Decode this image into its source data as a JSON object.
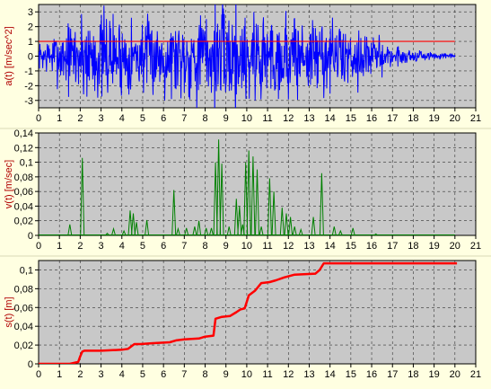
{
  "window": {
    "background": "#FFFFE1"
  },
  "chart_data": [
    {
      "type": "line",
      "ylabel": "a(t) [m/sec^2]",
      "xlim": [
        0,
        21
      ],
      "ylim": [
        -3.5,
        3.5
      ],
      "xticks": [
        "0",
        "1",
        "2",
        "3",
        "4",
        "5",
        "6",
        "7",
        "8",
        "9",
        "10",
        "11",
        "12",
        "13",
        "14",
        "15",
        "16",
        "17",
        "18",
        "19",
        "20",
        "21"
      ],
      "yticks": [
        {
          "v": -3,
          "label": "-3"
        },
        {
          "v": -2,
          "label": "-2"
        },
        {
          "v": -1,
          "label": "-1"
        },
        {
          "v": 0,
          "label": "0"
        },
        {
          "v": 1,
          "label": "1"
        },
        {
          "v": 2,
          "label": "2"
        },
        {
          "v": 3,
          "label": "3"
        }
      ],
      "grid": true,
      "series": [
        {
          "kind": "noise",
          "color": "#0000FF",
          "x_range": [
            0,
            20
          ],
          "n": 1000,
          "seed": 7,
          "envelope": [
            [
              0,
              0.5
            ],
            [
              1,
              1.2
            ],
            [
              2,
              1.9
            ],
            [
              3,
              1.9
            ],
            [
              5,
              1.5
            ],
            [
              7,
              1.8
            ],
            [
              8.5,
              2.1
            ],
            [
              9.5,
              2.3
            ],
            [
              11,
              2.1
            ],
            [
              13,
              1.7
            ],
            [
              15,
              1.3
            ],
            [
              16,
              0.9
            ],
            [
              17,
              0.5
            ],
            [
              18,
              0.3
            ],
            [
              19,
              0.15
            ],
            [
              20,
              0.08
            ]
          ]
        },
        {
          "kind": "hline",
          "color": "#FF0000",
          "y": 1,
          "x_range": [
            0,
            20
          ]
        }
      ]
    },
    {
      "type": "line",
      "ylabel": "v(t) [m/sec]",
      "xlim": [
        0,
        21
      ],
      "ylim": [
        0,
        0.14
      ],
      "xticks": [
        "0",
        "1",
        "2",
        "3",
        "4",
        "5",
        "6",
        "7",
        "8",
        "9",
        "10",
        "11",
        "12",
        "13",
        "14",
        "15",
        "16",
        "17",
        "18",
        "19",
        "20",
        "21"
      ],
      "yticks": [
        {
          "v": 0,
          "label": "0"
        },
        {
          "v": 0.02,
          "label": "0,02"
        },
        {
          "v": 0.04,
          "label": "0,04"
        },
        {
          "v": 0.06,
          "label": "0,06"
        },
        {
          "v": 0.08,
          "label": "0,08"
        },
        {
          "v": 0.1,
          "label": "0,1"
        },
        {
          "v": 0.12,
          "label": "0,12"
        },
        {
          "v": 0.14,
          "label": "0,14"
        }
      ],
      "grid": true,
      "series": [
        {
          "kind": "spikes",
          "color": "#008000",
          "points": [
            [
              1.5,
              0.015
            ],
            [
              2.1,
              0.106
            ],
            [
              3.3,
              0.003
            ],
            [
              3.6,
              0.009
            ],
            [
              4.1,
              0.006
            ],
            [
              4.4,
              0.034
            ],
            [
              4.55,
              0.03
            ],
            [
              4.7,
              0.018
            ],
            [
              5.2,
              0.021
            ],
            [
              6.5,
              0.062
            ],
            [
              6.7,
              0.009
            ],
            [
              7.1,
              0.01
            ],
            [
              7.5,
              0.012
            ],
            [
              7.7,
              0.02
            ],
            [
              8.05,
              0.01
            ],
            [
              8.3,
              0.01
            ],
            [
              8.5,
              0.1
            ],
            [
              8.65,
              0.131
            ],
            [
              8.8,
              0.098
            ],
            [
              9.15,
              0.012
            ],
            [
              9.5,
              0.05
            ],
            [
              9.65,
              0.04
            ],
            [
              9.8,
              0.015
            ],
            [
              9.95,
              0.1
            ],
            [
              10.1,
              0.116
            ],
            [
              10.3,
              0.108
            ],
            [
              10.5,
              0.09
            ],
            [
              10.7,
              0.012
            ],
            [
              11.1,
              0.078
            ],
            [
              11.3,
              0.06
            ],
            [
              11.7,
              0.038
            ],
            [
              11.9,
              0.03
            ],
            [
              12.1,
              0.025
            ],
            [
              12.3,
              0.012
            ],
            [
              12.6,
              0.008
            ],
            [
              13.2,
              0.025
            ],
            [
              13.6,
              0.085
            ],
            [
              14.2,
              0.012
            ],
            [
              14.5,
              0.006
            ],
            [
              15.1,
              0.01
            ],
            [
              16.2,
              0.002
            ]
          ]
        }
      ]
    },
    {
      "type": "line",
      "ylabel": "s(t) [m]",
      "xlim": [
        0,
        21
      ],
      "ylim": [
        0,
        0.11
      ],
      "xticks": [
        "0",
        "1",
        "2",
        "3",
        "4",
        "5",
        "6",
        "7",
        "8",
        "9",
        "10",
        "11",
        "12",
        "13",
        "14",
        "15",
        "16",
        "17",
        "18",
        "19",
        "20",
        "21"
      ],
      "yticks": [
        {
          "v": 0,
          "label": "0"
        },
        {
          "v": 0.02,
          "label": "0,02"
        },
        {
          "v": 0.04,
          "label": "0,04"
        },
        {
          "v": 0.06,
          "label": "0,06"
        },
        {
          "v": 0.08,
          "label": "0,08"
        },
        {
          "v": 0.1,
          "label": "0,1"
        }
      ],
      "grid": true,
      "series": [
        {
          "kind": "line",
          "color": "#FF0000",
          "x": [
            0,
            1.5,
            1.9,
            2.0,
            2.1,
            2.2,
            3.0,
            4.0,
            4.3,
            4.6,
            4.9,
            5.5,
            6.3,
            6.6,
            7.0,
            7.7,
            8.0,
            8.4,
            8.5,
            8.8,
            9.2,
            9.5,
            9.7,
            9.9,
            10.1,
            10.4,
            10.7,
            11.1,
            11.4,
            11.8,
            12.3,
            13.3,
            13.5,
            13.7,
            14.2,
            15.0,
            16.0,
            18.0,
            20.1
          ],
          "y": [
            0,
            0,
            0.002,
            0.008,
            0.013,
            0.014,
            0.014,
            0.015,
            0.016,
            0.021,
            0.021,
            0.022,
            0.023,
            0.025,
            0.026,
            0.027,
            0.029,
            0.03,
            0.048,
            0.05,
            0.051,
            0.055,
            0.058,
            0.059,
            0.073,
            0.078,
            0.086,
            0.087,
            0.089,
            0.092,
            0.095,
            0.096,
            0.1,
            0.107,
            0.107,
            0.107,
            0.107,
            0.107,
            0.107
          ]
        }
      ]
    }
  ]
}
